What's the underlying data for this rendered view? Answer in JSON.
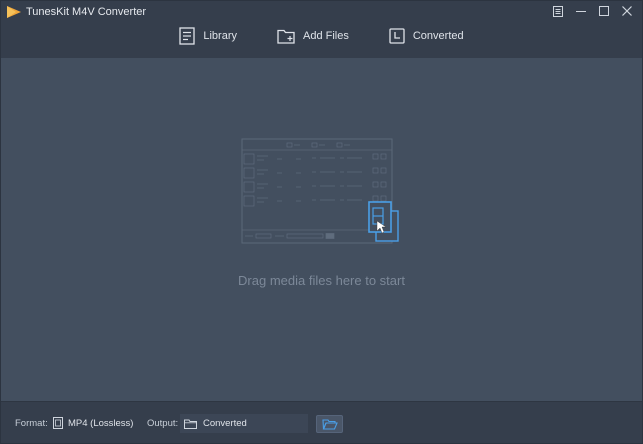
{
  "app": {
    "title": "TunesKit M4V Converter"
  },
  "toolbar": {
    "library_label": "Library",
    "add_files_label": "Add Files",
    "converted_label": "Converted"
  },
  "main": {
    "drag_hint": "Drag media files here to start"
  },
  "bottom": {
    "format_label": "Format:",
    "format_value": "MP4 (Lossless)",
    "output_label": "Output:",
    "output_value": "Converted"
  },
  "icons": {
    "logo": "tuneskit-logo-icon",
    "menu": "menu-icon",
    "minimize": "minimize-icon",
    "maximize": "maximize-icon",
    "close": "close-icon",
    "library": "library-icon",
    "add_files": "add-folder-icon",
    "converted": "clock-icon",
    "format": "video-file-icon",
    "output_folder": "folder-icon",
    "browse": "open-folder-icon"
  },
  "colors": {
    "background": "#434f5f",
    "bars": "#353e4c",
    "accent_blue": "#4a9fe6",
    "logo_orange": "#f0a63a"
  }
}
